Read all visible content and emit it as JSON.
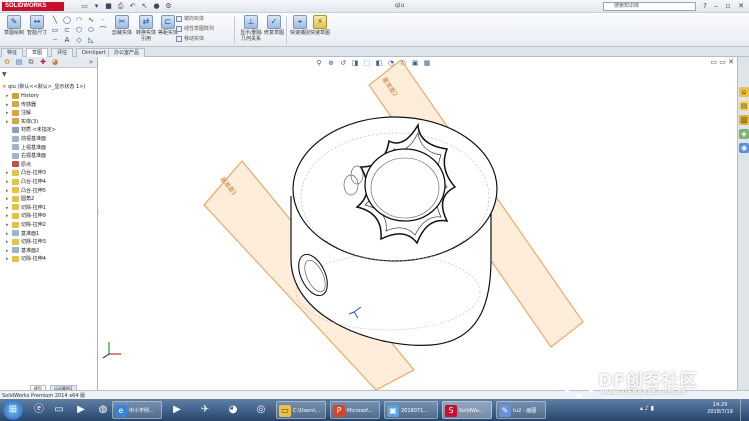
{
  "app": {
    "brand": "SOLIDWORKS",
    "document_title": "qiu",
    "search_placeholder": "搜索知识库",
    "window_controls": [
      "?",
      "–",
      "▫",
      "✕"
    ]
  },
  "ribbon": {
    "big_buttons": [
      {
        "label": "草图绘制",
        "icon": "sketch-icon"
      },
      {
        "label": "智能尺寸",
        "icon": "smart-dimension-icon"
      },
      {
        "label": "剪裁实体",
        "icon": "trim-icon"
      },
      {
        "label": "转换实体引用",
        "icon": "convert-entities-icon"
      },
      {
        "label": "等距实体",
        "icon": "offset-icon"
      },
      {
        "label": "显示/删除几何关系",
        "icon": "relations-icon"
      },
      {
        "label": "修复草图",
        "icon": "repair-icon"
      },
      {
        "label": "快速捕捉",
        "icon": "quick-snaps-icon"
      },
      {
        "label": "快速草图",
        "icon": "rapid-sketch-icon"
      }
    ],
    "small_buttons": [
      "镜向实体",
      "线性草图阵列",
      "移动实体"
    ]
  },
  "command_tabs": [
    "特征",
    "草图",
    "评估",
    "DimXpert",
    "办公室产品"
  ],
  "left_panel": {
    "tree_root": "qiu (默认<<默认>_显示状态 1>)",
    "tree_items": [
      {
        "label": "History",
        "icon": "history-icon",
        "color": "#c9a23a"
      },
      {
        "label": "传感器",
        "icon": "sensor-icon",
        "color": "#d9a441"
      },
      {
        "label": "注解",
        "icon": "annotations-icon",
        "color": "#d9a441"
      },
      {
        "label": "实体(3)",
        "icon": "solid-bodies-icon",
        "color": "#d9a441"
      },
      {
        "label": "材质 <未指定>",
        "icon": "material-icon",
        "color": "#8aa0b8"
      },
      {
        "label": "前视基准面",
        "icon": "plane-icon",
        "color": "#9fb3c9"
      },
      {
        "label": "上视基准面",
        "icon": "plane-icon",
        "color": "#9fb3c9"
      },
      {
        "label": "右视基准面",
        "icon": "plane-icon",
        "color": "#9fb3c9"
      },
      {
        "label": "原点",
        "icon": "origin-icon",
        "color": "#c0504d"
      },
      {
        "label": "凸台-拉伸3",
        "icon": "boss-extrude-icon",
        "color": "#e3c247"
      },
      {
        "label": "凸台-拉伸4",
        "icon": "boss-extrude-icon",
        "color": "#e3c247"
      },
      {
        "label": "凸台-拉伸5",
        "icon": "boss-extrude-icon",
        "color": "#e3c247"
      },
      {
        "label": "圆角2",
        "icon": "fillet-icon",
        "color": "#e3c247"
      },
      {
        "label": "切除-拉伸1",
        "icon": "cut-extrude-icon",
        "color": "#e3c247"
      },
      {
        "label": "切除-拉伸9",
        "icon": "cut-extrude-icon",
        "color": "#e3c247"
      },
      {
        "label": "切除-拉伸2",
        "icon": "cut-extrude-icon",
        "color": "#e3c247"
      },
      {
        "label": "基准面1",
        "icon": "plane-icon",
        "color": "#9fb3c9"
      },
      {
        "label": "切除-拉伸3",
        "icon": "cut-extrude-icon",
        "color": "#e3c247"
      },
      {
        "label": "基准面2",
        "icon": "plane-icon",
        "color": "#9fb3c9"
      },
      {
        "label": "切除-拉伸4",
        "icon": "cut-extrude-icon",
        "color": "#e3c247"
      }
    ],
    "bottom_tabs": [
      "模型",
      "运动算例1"
    ]
  },
  "viewport": {
    "plane_labels": [
      "基准面2",
      "基准面1"
    ],
    "plane_color": "#f2a65a"
  },
  "status_bar": {
    "text": "SolidWorks Premium 2014 x64 版"
  },
  "taskbar": {
    "apps": [
      {
        "label": "中小学例...",
        "icon": "browser-icon",
        "active": false
      },
      {
        "label": "C:\\Users\\...",
        "icon": "folder-icon",
        "active": false
      },
      {
        "label": "Microsof...",
        "icon": "powerpoint-icon",
        "active": false
      },
      {
        "label": "2018071...",
        "icon": "image-icon",
        "active": false
      },
      {
        "label": "SolidWo...",
        "icon": "solidworks-icon",
        "active": true
      },
      {
        "label": "tu2 - 画图",
        "icon": "paint-icon",
        "active": false
      }
    ],
    "clock_time": "14:29",
    "clock_date": "2018/7/19"
  },
  "watermark": {
    "title": "DF创客社区",
    "url": "www.DFRobot.com.cn"
  }
}
